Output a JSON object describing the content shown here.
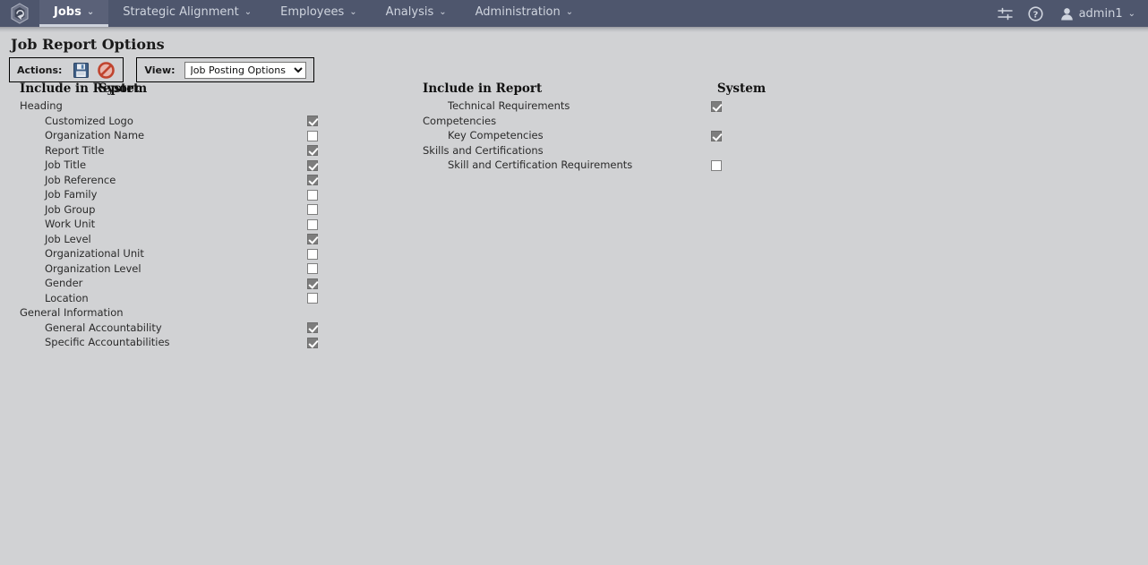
{
  "nav": {
    "logo_icon": "hexagon-logo-icon",
    "items": [
      {
        "label": "Jobs",
        "caret": "⌄",
        "active": true
      },
      {
        "label": "Strategic Alignment",
        "caret": "⌄",
        "active": false
      },
      {
        "label": "Employees",
        "caret": "⌄",
        "active": false
      },
      {
        "label": "Analysis",
        "caret": "⌄",
        "active": false
      },
      {
        "label": "Administration",
        "caret": "⌄",
        "active": false
      }
    ],
    "right": {
      "settings_icon": "sliders-icon",
      "help_icon": "help-circle-icon",
      "user_icon": "user-avatar-icon",
      "user_name": "admin1",
      "user_caret": "⌄"
    }
  },
  "page": {
    "title": "Job Report Options"
  },
  "toolbar": {
    "actions_label": "Actions:",
    "save_icon": "save-floppy-icon",
    "cancel_icon": "cancel-prohibited-icon",
    "view_label": "View:",
    "view_selected": "Job Posting Options",
    "view_options": [
      "Job Posting Options"
    ]
  },
  "columns": {
    "left": {
      "header_label": "Include in Report",
      "header_system": "System",
      "rows": [
        {
          "label": "Heading",
          "type": "group",
          "checkbox": null
        },
        {
          "label": "Customized Logo",
          "type": "child",
          "checkbox": true
        },
        {
          "label": "Organization Name",
          "type": "child",
          "checkbox": false
        },
        {
          "label": "Report Title",
          "type": "child",
          "checkbox": true
        },
        {
          "label": "Job Title",
          "type": "child",
          "checkbox": true
        },
        {
          "label": "Job Reference",
          "type": "child",
          "checkbox": true
        },
        {
          "label": "Job Family",
          "type": "child",
          "checkbox": false
        },
        {
          "label": "Job Group",
          "type": "child",
          "checkbox": false
        },
        {
          "label": "Work Unit",
          "type": "child",
          "checkbox": false
        },
        {
          "label": "Job Level",
          "type": "child",
          "checkbox": true
        },
        {
          "label": "Organizational Unit",
          "type": "child",
          "checkbox": false
        },
        {
          "label": "Organization Level",
          "type": "child",
          "checkbox": false
        },
        {
          "label": "Gender",
          "type": "child",
          "checkbox": true
        },
        {
          "label": "Location",
          "type": "child",
          "checkbox": false
        },
        {
          "label": "General Information",
          "type": "group",
          "checkbox": null
        },
        {
          "label": "General Accountability",
          "type": "child",
          "checkbox": true
        },
        {
          "label": "Specific Accountabilities",
          "type": "child",
          "checkbox": true
        }
      ]
    },
    "right": {
      "header_label": "Include in Report",
      "header_system": "System",
      "rows": [
        {
          "label": "Technical Requirements",
          "type": "child",
          "checkbox": true
        },
        {
          "label": "Competencies",
          "type": "group",
          "checkbox": null
        },
        {
          "label": "Key Competencies",
          "type": "child",
          "checkbox": true
        },
        {
          "label": "Skills and Certifications",
          "type": "group",
          "checkbox": null
        },
        {
          "label": "Skill and Certification Requirements",
          "type": "child",
          "checkbox": false
        }
      ]
    }
  },
  "colors": {
    "nav_bg": "#4e566d",
    "nav_active_bg": "#5a6178",
    "page_bg": "#d1d2d4",
    "checkbox_checked": "#7d7d7d",
    "text": "#2a2a2a"
  }
}
